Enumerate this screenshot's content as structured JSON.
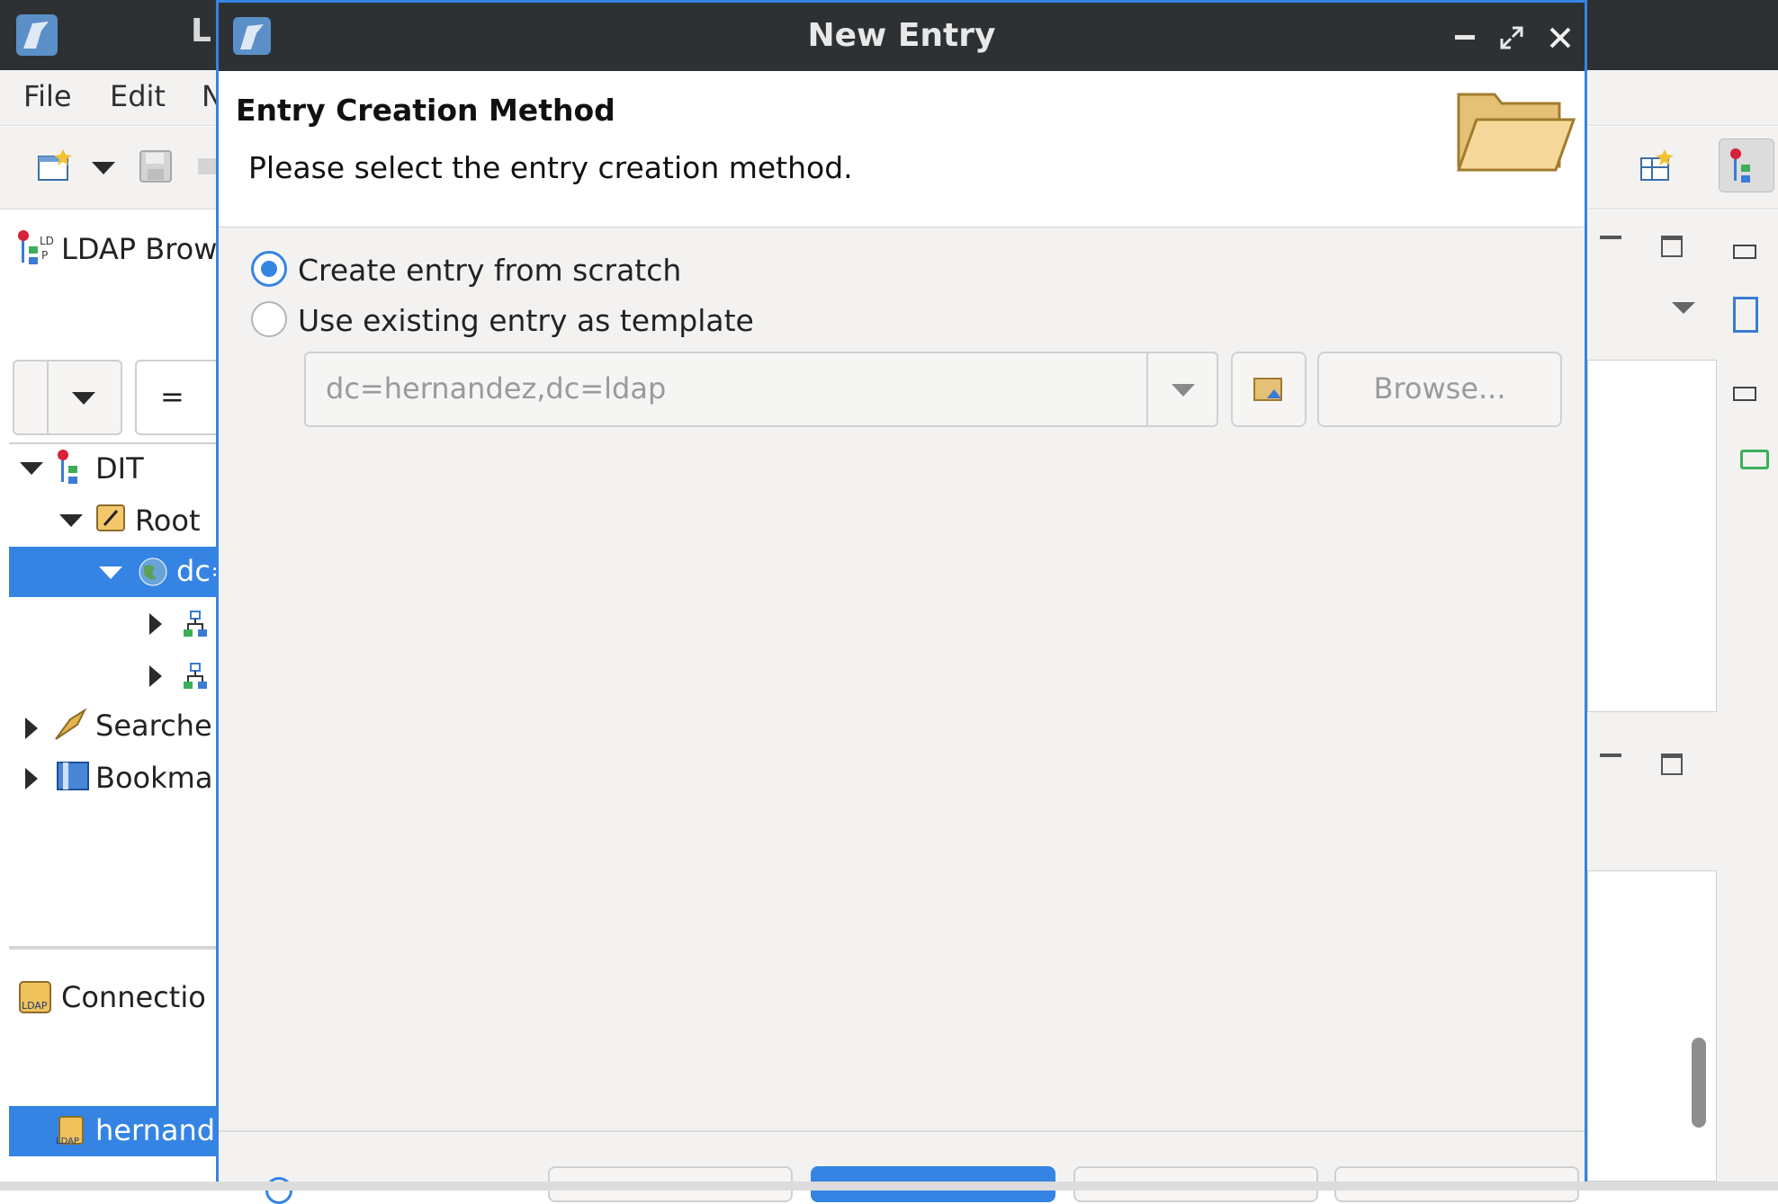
{
  "app": {
    "title_fragment": "L",
    "menu": [
      "File",
      "Edit",
      "N"
    ],
    "left_view_title": "LDAP Brow",
    "filter_operator": "=",
    "tree": {
      "dit": "DIT",
      "root": "Root",
      "selected_partial": "dc=",
      "searches": "Searche",
      "bookmarks": "Bookma"
    },
    "connections_title": "Connectio",
    "connection_item": "hernand"
  },
  "dialog": {
    "title": "New Entry",
    "header_title": "Entry Creation Method",
    "header_desc": "Please select the entry creation method.",
    "options": {
      "scratch": "Create entry from scratch",
      "template": "Use existing entry as template"
    },
    "selected_option": "scratch",
    "template_dn": "dc=hernandez,dc=ldap",
    "browse_label": "Browse..."
  },
  "colors": {
    "accent": "#3584e4",
    "titlebar": "#2e3134",
    "window_bg": "#f3f2f1"
  }
}
